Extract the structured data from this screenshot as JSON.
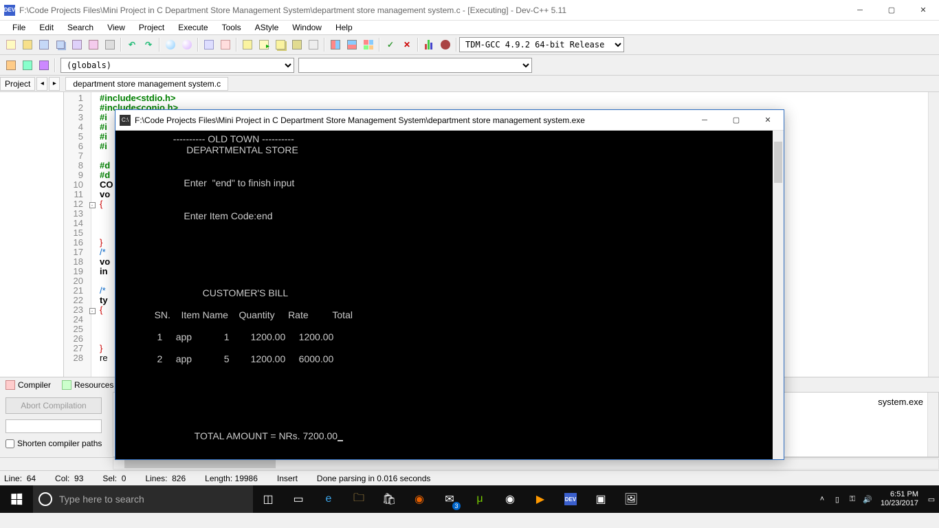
{
  "titlebar": {
    "icon_text": "DEV",
    "title": "F:\\Code Projects Files\\Mini Project in C Department Store Management System\\department store management system.c - [Executing] - Dev-C++ 5.11"
  },
  "menu": [
    "File",
    "Edit",
    "Search",
    "View",
    "Project",
    "Execute",
    "Tools",
    "AStyle",
    "Window",
    "Help"
  ],
  "compiler_dropdown": "TDM-GCC 4.9.2 64-bit Release",
  "globals_dropdown": "(globals)",
  "project_label": "Project",
  "file_tab": "department store management system.c",
  "code_lines": [
    {
      "n": 1,
      "cls": "kw-green",
      "text": "#include<stdio.h>"
    },
    {
      "n": 2,
      "cls": "kw-green",
      "text": "#include<conio.h>"
    },
    {
      "n": 3,
      "cls": "kw-green",
      "text": "#i"
    },
    {
      "n": 4,
      "cls": "kw-green",
      "text": "#i"
    },
    {
      "n": 5,
      "cls": "kw-green",
      "text": "#i"
    },
    {
      "n": 6,
      "cls": "kw-green",
      "text": "#i"
    },
    {
      "n": 7,
      "cls": "",
      "text": ""
    },
    {
      "n": 8,
      "cls": "kw-green",
      "text": "#d"
    },
    {
      "n": 9,
      "cls": "kw-green",
      "text": "#d"
    },
    {
      "n": 10,
      "cls": "kw-bold",
      "text": "CO"
    },
    {
      "n": 11,
      "cls": "kw-bold",
      "text": "vo"
    },
    {
      "n": 12,
      "cls": "brace-red",
      "text": "{",
      "fold": true
    },
    {
      "n": 13,
      "cls": "",
      "text": ""
    },
    {
      "n": 14,
      "cls": "",
      "text": ""
    },
    {
      "n": 15,
      "cls": "",
      "text": ""
    },
    {
      "n": 16,
      "cls": "brace-red",
      "text": "}"
    },
    {
      "n": 17,
      "cls": "",
      "text": "/*",
      "color": "#0064c8"
    },
    {
      "n": 18,
      "cls": "kw-bold",
      "text": "vo"
    },
    {
      "n": 19,
      "cls": "kw-bold",
      "text": "in"
    },
    {
      "n": 20,
      "cls": "",
      "text": ""
    },
    {
      "n": 21,
      "cls": "",
      "text": "/*",
      "color": "#0064c8"
    },
    {
      "n": 22,
      "cls": "kw-bold",
      "text": "ty"
    },
    {
      "n": 23,
      "cls": "brace-red",
      "text": "{",
      "fold": true
    },
    {
      "n": 24,
      "cls": "",
      "text": ""
    },
    {
      "n": 25,
      "cls": "",
      "text": ""
    },
    {
      "n": 26,
      "cls": "",
      "text": ""
    },
    {
      "n": 27,
      "cls": "brace-red",
      "text": "}"
    },
    {
      "n": 28,
      "cls": "",
      "text": "re"
    }
  ],
  "bottom_tabs": {
    "compiler": "Compiler",
    "resources": "Resources"
  },
  "compiler_panel": {
    "abort": "Abort Compilation",
    "shorten": "Shorten compiler paths",
    "output_fragment": "system.exe"
  },
  "statusbar": {
    "line": "Line:  64",
    "col": "Col:  93",
    "sel": "Sel:  0",
    "lines": "Lines:  826",
    "length": "Length: 19986",
    "insert": "Insert",
    "parse": "Done parsing in 0.016 seconds"
  },
  "console": {
    "title": "F:\\Code Projects Files\\Mini Project in C Department Store Management System\\department store management system.exe",
    "header1": "---------- OLD TOWN ----------",
    "header2": "DEPARTMENTAL STORE",
    "prompt1": "Enter  \"end\" to finish input",
    "prompt2": "Enter Item Code:end",
    "bill_title": "CUSTOMER'S BILL",
    "columns": "   SN.    Item Name    Quantity     Rate         Total",
    "rows": [
      "    1     app            1        1200.00     1200.00",
      "    2     app            5        1200.00     6000.00"
    ],
    "total": "TOTAL AMOUNT = NRs. 7200.00"
  },
  "taskbar": {
    "search_placeholder": "Type here to search",
    "time": "6:51 PM",
    "date": "10/23/2017",
    "mail_badge": "3"
  }
}
